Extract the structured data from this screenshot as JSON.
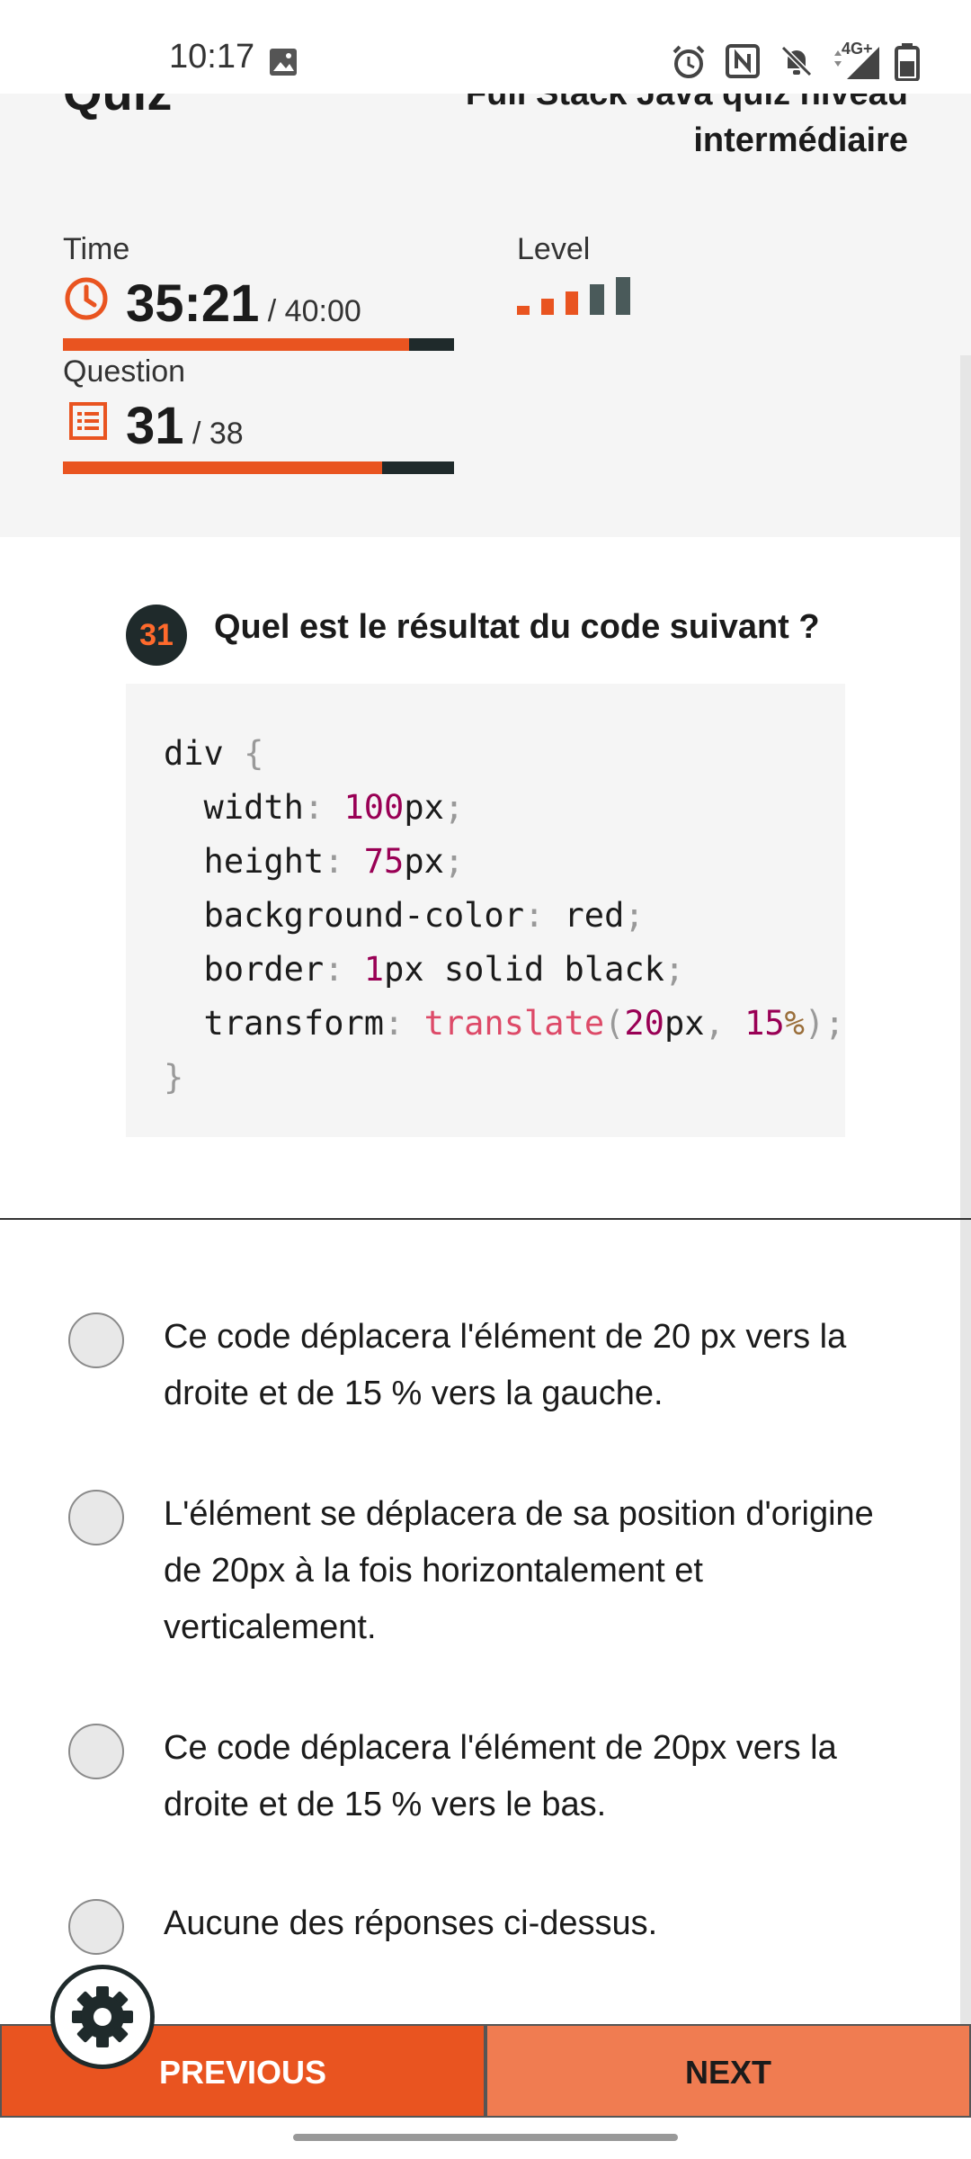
{
  "status_bar": {
    "time": "10:17",
    "network": "4G+"
  },
  "header": {
    "title": "Quiz",
    "quiz_name": "Full Stack Java quiz niveau intermédiaire",
    "time_label": "Time",
    "time_value": "35:21",
    "time_total": " / 40:00",
    "time_progress": 0.884,
    "level_label": "Level",
    "level_value": 3,
    "level_max": 5,
    "question_label": "Question",
    "question_value": "31",
    "question_total": " / 38",
    "question_progress": 0.816
  },
  "question": {
    "number": "31",
    "text": "Quel est le résultat du code suivant ?"
  },
  "options": [
    {
      "text": "Ce code déplacera l'élément de 20 px vers la droite et de 15 % vers la gauche."
    },
    {
      "text": "L'élément se déplacera de sa position d'origine de 20px à la fois horizontalement et verticalement."
    },
    {
      "text": "Ce code déplacera l'élément de 20px vers la droite et de 15 % vers le bas."
    },
    {
      "text": "Aucune des réponses ci-dessus."
    }
  ],
  "nav": {
    "previous_label": "PREVIOUS",
    "next_label": "NEXT"
  },
  "colors": {
    "accent": "#e95420",
    "accent_light": "#f07c51",
    "dark": "#1f2a2b",
    "header_bg": "#f5f5f5"
  }
}
